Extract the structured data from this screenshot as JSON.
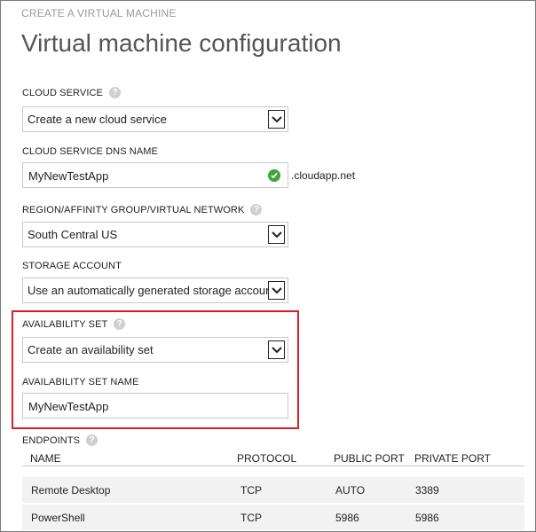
{
  "wizard": {
    "breadcrumb": "CREATE A VIRTUAL MACHINE",
    "title": "Virtual machine configuration"
  },
  "cloud_service": {
    "label": "CLOUD SERVICE",
    "selected": "Create a new cloud service"
  },
  "dns_name": {
    "label": "CLOUD SERVICE DNS NAME",
    "value": "MyNewTestApp",
    "suffix": ".cloudapp.net"
  },
  "region": {
    "label": "REGION/AFFINITY GROUP/VIRTUAL NETWORK",
    "selected": "South Central US"
  },
  "storage": {
    "label": "STORAGE ACCOUNT",
    "selected": "Use an automatically generated storage account"
  },
  "availability_set": {
    "label": "AVAILABILITY SET",
    "selected": "Create an availability set"
  },
  "availability_set_name": {
    "label": "AVAILABILITY SET NAME",
    "value": "MyNewTestApp"
  },
  "endpoints": {
    "label": "ENDPOINTS",
    "columns": [
      "NAME",
      "PROTOCOL",
      "PUBLIC PORT",
      "PRIVATE PORT"
    ],
    "rows": [
      [
        "Remote Desktop",
        "TCP",
        "AUTO",
        "3389"
      ],
      [
        "PowerShell",
        "TCP",
        "5986",
        "5986"
      ]
    ]
  },
  "colors": {
    "highlight_border": "#d5202a",
    "valid_check": "#3fa43a",
    "help_icon": "#cfcfcf"
  }
}
